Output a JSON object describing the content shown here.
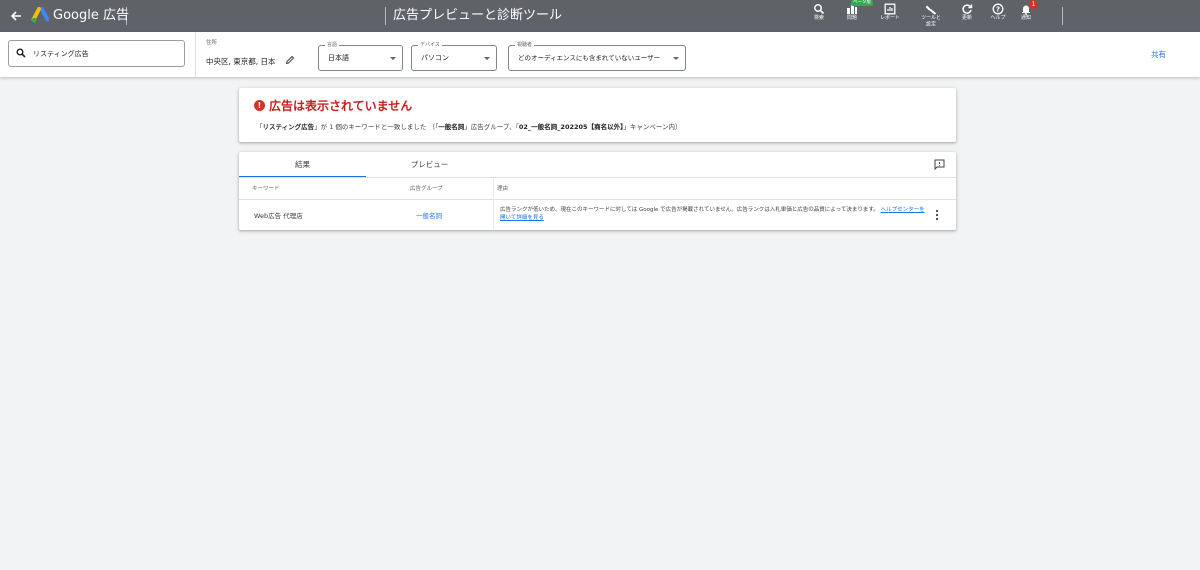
{
  "header": {
    "app_name": "Google 広告",
    "page_title": "広告プレビューと診断ツール",
    "toolbar": [
      {
        "label": "検索",
        "icon": "search-icon"
      },
      {
        "label": "問題",
        "icon": "issues-icon",
        "badge": "ベータ版"
      },
      {
        "label": "レポート",
        "icon": "report-icon"
      },
      {
        "label": "ツールと\n設定",
        "icon": "wrench-icon"
      },
      {
        "label": "更新",
        "icon": "refresh-icon"
      },
      {
        "label": "ヘルプ",
        "icon": "help-icon"
      },
      {
        "label": "通知",
        "icon": "bell-icon",
        "count": "1"
      }
    ]
  },
  "filters": {
    "search_value": "リスティング広告",
    "location": {
      "label": "住所",
      "value": "中央区, 東京都, 日本"
    },
    "language": {
      "label": "言語",
      "value": "日本語"
    },
    "device": {
      "label": "デバイス",
      "value": "パソコン"
    },
    "audience": {
      "label": "視聴者",
      "value": "どのオーディエンスにも含まれていないユーザー"
    },
    "share_label": "共有"
  },
  "status": {
    "title": "広告は表示されていません",
    "desc_pre": "「",
    "keyword": "リスティング広告",
    "desc_mid1": "」が 1 個のキーワードと一致しました （「",
    "ad_group": "一般名詞",
    "desc_mid2": "」広告グループ、「",
    "campaign": "02_一般名詞_202205【商名以外】",
    "desc_post": "」キャンペーン内）"
  },
  "results": {
    "tabs": [
      "結果",
      "プレビュー"
    ],
    "columns": [
      "キーワード",
      "広告グループ",
      "理由"
    ],
    "rows": [
      {
        "keyword": "Web広告 代理店",
        "ad_group": "一般名詞",
        "reason": "広告ランクが低いため、現在このキーワードに対しては Google で広告が掲載されていません。広告ランクは入札単価と広告の品質によって決まります。",
        "help_link": "ヘルプセンターを開いて詳細を見る"
      }
    ]
  },
  "colors": {
    "topbar": "#5f6368",
    "accent": "#1a73e8",
    "error": "#d93025"
  }
}
